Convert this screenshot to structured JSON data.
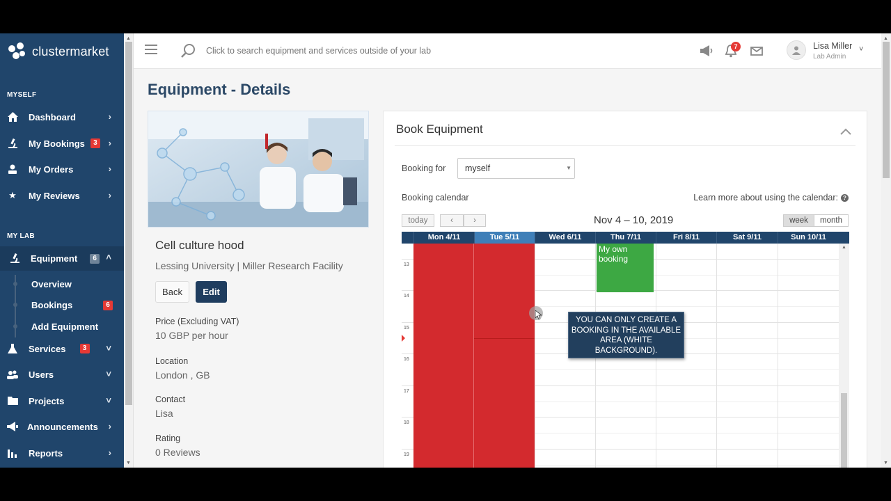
{
  "brand": {
    "name": "clustermarket"
  },
  "sidebar": {
    "section_myself": "MYSELF",
    "section_mylab": "MY LAB",
    "items": [
      {
        "label": "Dashboard",
        "icon": "home-icon"
      },
      {
        "label": "My Bookings",
        "icon": "microscope-icon",
        "badge": "3"
      },
      {
        "label": "My Orders",
        "icon": "user-icon"
      },
      {
        "label": "My Reviews",
        "icon": "star-icon"
      },
      {
        "label": "Equipment",
        "icon": "microscope-icon",
        "badge": "6"
      },
      {
        "label": "Services",
        "icon": "flask-icon",
        "badge": "3"
      },
      {
        "label": "Users",
        "icon": "users-icon"
      },
      {
        "label": "Projects",
        "icon": "folder-icon"
      },
      {
        "label": "Announcements",
        "icon": "megaphone-icon"
      },
      {
        "label": "Reports",
        "icon": "bar-chart-icon"
      }
    ],
    "equipment_sub": [
      {
        "label": "Overview"
      },
      {
        "label": "Bookings",
        "badge": "6"
      },
      {
        "label": "Add Equipment"
      }
    ]
  },
  "topbar": {
    "search_placeholder": "Click to search equipment and services outside of your lab",
    "notification_count": "7",
    "user_name": "Lisa Miller",
    "user_role": "Lab Admin"
  },
  "page": {
    "title": "Equipment - Details",
    "equipment_name": "Cell culture hood",
    "location_line": "Lessing University | Miller Research Facility",
    "back_label": "Back",
    "edit_label": "Edit",
    "price_label": "Price (Excluding VAT)",
    "price_value": "10 GBP per hour",
    "location_label": "Location",
    "location_value": "London , GB",
    "contact_label": "Contact",
    "contact_value": "Lisa",
    "rating_label": "Rating",
    "rating_value": "0 Reviews"
  },
  "book": {
    "title": "Book Equipment",
    "booking_for_label": "Booking for",
    "booking_for_value": "myself",
    "calendar_label": "Booking calendar",
    "calendar_help": "Learn more about using the calendar:",
    "today_label": "today",
    "range": "Nov 4 – 10, 2019",
    "week_label": "week",
    "month_label": "month",
    "days": [
      "Mon 4/11",
      "Tue 5/11",
      "Wed 6/11",
      "Thu 7/11",
      "Fri 8/11",
      "Sat 9/11",
      "Sun 10/11"
    ],
    "hours": [
      "13",
      "14",
      "15",
      "16",
      "17",
      "18",
      "19"
    ],
    "own_booking": "My own booking",
    "colors": {
      "unavailable": "#d32a2e",
      "own_booking": "#3da843",
      "header": "#20456b"
    }
  },
  "tooltip": {
    "text": "YOU CAN ONLY CREATE A BOOKING IN THE AVAILABLE AREA (WHITE BACKGROUND)."
  }
}
